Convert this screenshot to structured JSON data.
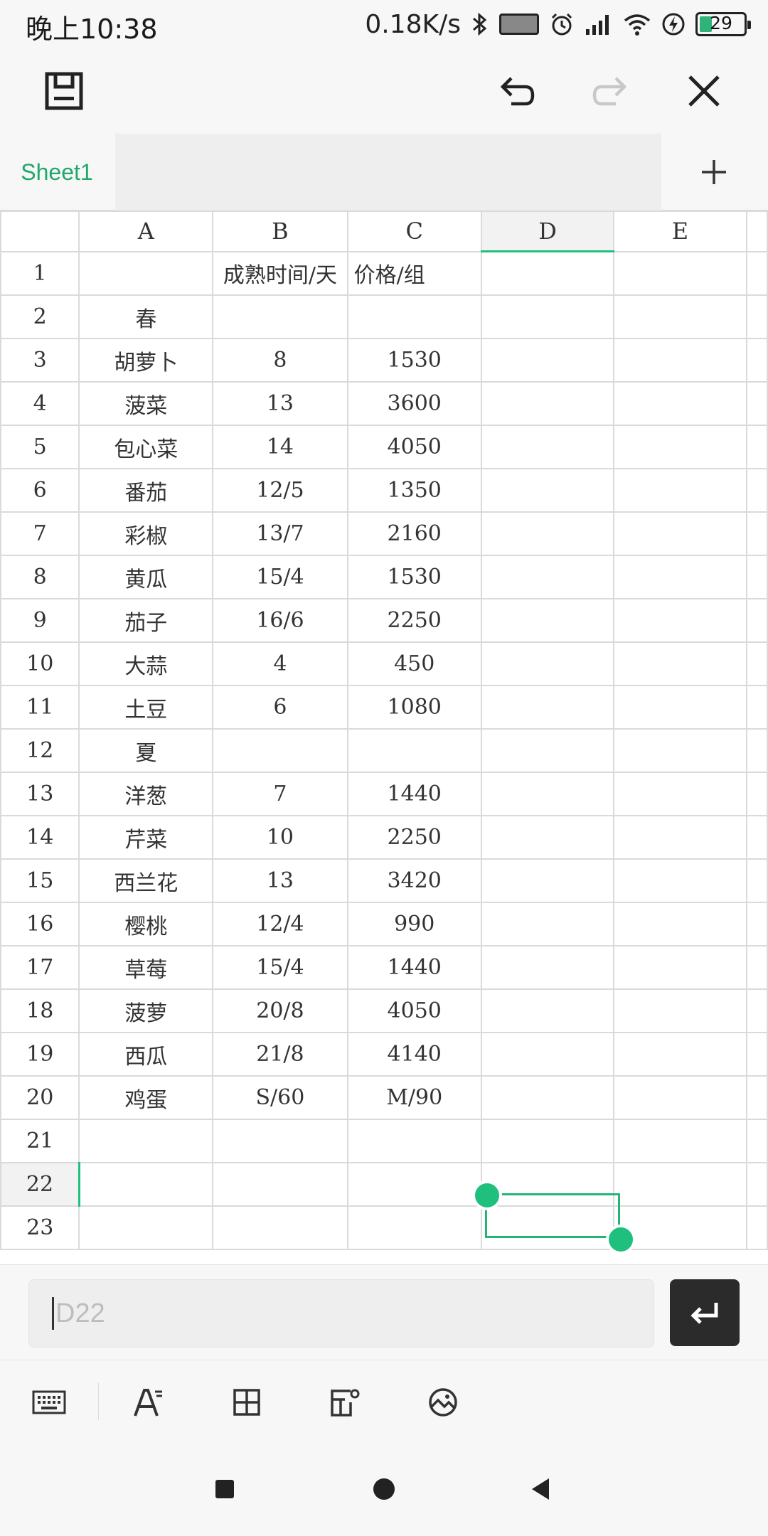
{
  "status": {
    "time": "晚上10:38",
    "speed": "0.18K/s",
    "battery": "29",
    "battery_level_pct": 29
  },
  "toolbar": {
    "save": "save-icon",
    "undo": "undo-icon",
    "redo": "redo-icon",
    "close": "close-icon"
  },
  "tabs": {
    "active": "Sheet1",
    "add": "plus-icon"
  },
  "sheet": {
    "columns": [
      "A",
      "B",
      "C",
      "D",
      "E"
    ],
    "selected_column": "D",
    "selected_row": "22",
    "rows": [
      {
        "n": "1",
        "a": "",
        "b": "成熟时间/天",
        "c": "价格/组"
      },
      {
        "n": "2",
        "a": "春",
        "b": "",
        "c": ""
      },
      {
        "n": "3",
        "a": "胡萝卜",
        "b": "8",
        "c": "1530"
      },
      {
        "n": "4",
        "a": "菠菜",
        "b": "13",
        "c": "3600"
      },
      {
        "n": "5",
        "a": "包心菜",
        "b": "14",
        "c": "4050"
      },
      {
        "n": "6",
        "a": "番茄",
        "b": "12/5",
        "c": "1350"
      },
      {
        "n": "7",
        "a": "彩椒",
        "b": "13/7",
        "c": "2160"
      },
      {
        "n": "8",
        "a": "黄瓜",
        "b": "15/4",
        "c": "1530"
      },
      {
        "n": "9",
        "a": "茄子",
        "b": "16/6",
        "c": "2250"
      },
      {
        "n": "10",
        "a": "大蒜",
        "b": "4",
        "c": "450"
      },
      {
        "n": "11",
        "a": "土豆",
        "b": "6",
        "c": "1080"
      },
      {
        "n": "12",
        "a": "夏",
        "b": "",
        "c": ""
      },
      {
        "n": "13",
        "a": "洋葱",
        "b": "7",
        "c": "1440"
      },
      {
        "n": "14",
        "a": "芹菜",
        "b": "10",
        "c": "2250"
      },
      {
        "n": "15",
        "a": "西兰花",
        "b": "13",
        "c": "3420"
      },
      {
        "n": "16",
        "a": "樱桃",
        "b": "12/4",
        "c": "990"
      },
      {
        "n": "17",
        "a": "草莓",
        "b": "15/4",
        "c": "1440"
      },
      {
        "n": "18",
        "a": "菠萝",
        "b": "20/8",
        "c": "4050"
      },
      {
        "n": "19",
        "a": "西瓜",
        "b": "21/8",
        "c": "4140"
      },
      {
        "n": "20",
        "a": "鸡蛋",
        "b": "S/60",
        "c": "M/90"
      },
      {
        "n": "21",
        "a": "",
        "b": "",
        "c": ""
      },
      {
        "n": "22",
        "a": "",
        "b": "",
        "c": ""
      },
      {
        "n": "23",
        "a": "",
        "b": "",
        "c": ""
      }
    ]
  },
  "input": {
    "placeholder": "D22",
    "enter": "enter-icon"
  },
  "tools": [
    "keyboard-icon",
    "text-format-icon",
    "cell-border-icon",
    "cell-settings-icon",
    "image-icon"
  ],
  "nav": [
    "recents-square-icon",
    "home-circle-icon",
    "back-triangle-icon"
  ],
  "colors": {
    "accent": "#1fbf7e",
    "tab_text": "#1fa86b",
    "enter_bg": "#2b2b2b"
  }
}
